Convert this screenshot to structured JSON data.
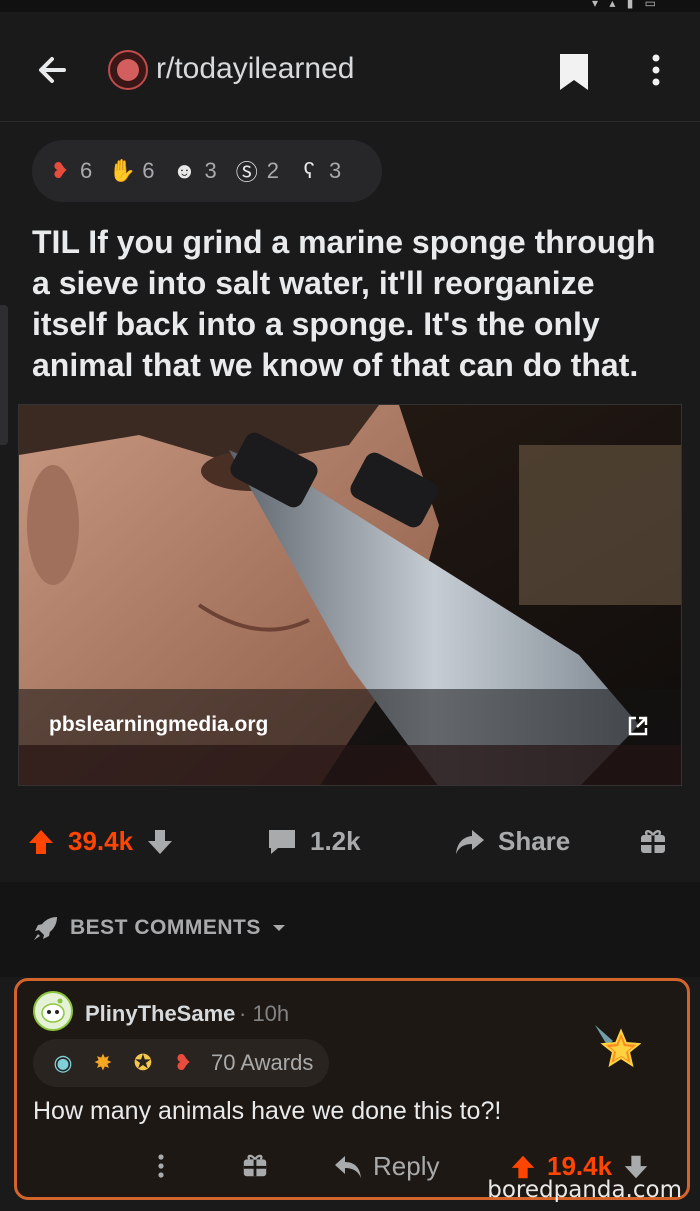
{
  "header": {
    "subreddit": "r/todayilearned",
    "icons": [
      "back-arrow-icon",
      "subreddit-icon",
      "bookmark-icon",
      "more-vertical-icon"
    ]
  },
  "post": {
    "awards": [
      {
        "icon": "rocket-heart-icon",
        "count": "6"
      },
      {
        "icon": "handshake-icon",
        "count": "6"
      },
      {
        "icon": "wholesome-seal-icon",
        "count": "3"
      },
      {
        "icon": "silver-coin-icon",
        "count": "2"
      },
      {
        "icon": "bear-hug-icon",
        "count": "3"
      }
    ],
    "title": "TIL If you grind a marine sponge through a sieve into salt water, it'll reorganize itself back into a sponge. It's the only animal that we know of that can do that.",
    "link_domain": "pbslearningmedia.org",
    "upvotes": "39.4k",
    "comments": "1.2k",
    "share_label": "Share"
  },
  "sort": {
    "label": "BEST COMMENTS"
  },
  "comment": {
    "author": "PlinyTheSame",
    "age": "· 10h",
    "awards_label": "70 Awards",
    "award_icons": [
      "helpful-icon",
      "explosion-icon",
      "gold-star-icon",
      "rocket-heart-icon"
    ],
    "body": "How many animals have we done this to?!",
    "reply_label": "Reply",
    "votes": "19.4k"
  },
  "watermark": "boredpanda.com",
  "colors": {
    "background": "#1a1a1b",
    "upvote": "#ff4500",
    "highlight_border": "#d3642b"
  }
}
